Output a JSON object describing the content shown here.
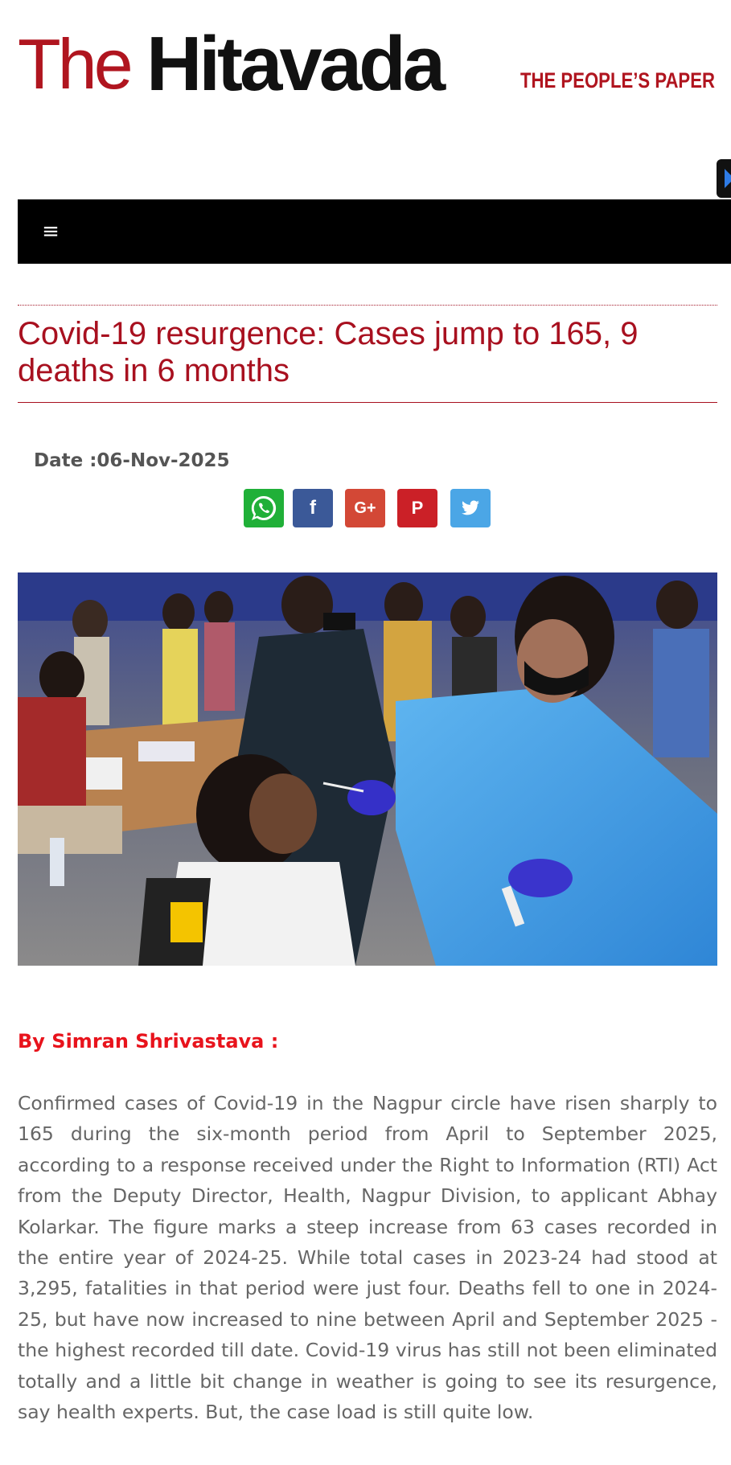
{
  "masthead": {
    "logo_the": "The",
    "logo_name": "Hitavada",
    "tagline": "THE PEOPLE’S PAPER"
  },
  "navbar": {
    "menu_icon": "menu-icon"
  },
  "article": {
    "headline": "Covid-19 resurgence: Cases jump to 165, 9 deaths in 6 months",
    "date": "Date :06-Nov-2025",
    "share": [
      {
        "name": "whatsapp",
        "icon": "whatsapp-icon",
        "color": "#20b038"
      },
      {
        "name": "facebook",
        "icon": "facebook-icon",
        "glyph": "f",
        "color": "#3b5998"
      },
      {
        "name": "google-plus",
        "icon": "google-plus-icon",
        "glyph": "G+",
        "color": "#d34836"
      },
      {
        "name": "pinterest",
        "icon": "pinterest-icon",
        "glyph": "P",
        "color": "#cb2027"
      },
      {
        "name": "twitter",
        "icon": "twitter-icon",
        "color": "#4ba6e6"
      }
    ],
    "byline": "By Simran Shrivastava :",
    "body": "Confirmed cases of Covid-19 in the Nagpur circle have risen sharply to 165 during the six-month period from April to September 2025, according to a response received under the Right to Information (RTI) Act from the Deputy Director, Health, Nagpur Division, to applicant Abhay Kolarkar. The figure marks a steep increase from 63 cases recorded in the entire year of 2024-25. While total cases in 2023-24 had stood at 3,295, fatalities in that period were just four. Deaths fell to one in 2024-25, but have now increased to nine between April and September 2025 - the highest recorded till date. Covid-19 virus has still not been eliminated totally and a little bit change in weather is going to see its resurgence, say health experts. But, the case load is still quite low."
  },
  "colors": {
    "brand_red": "#b0151f",
    "headline_red": "#a8101f",
    "byline_red": "#e8131c",
    "navbar": "#000000"
  }
}
